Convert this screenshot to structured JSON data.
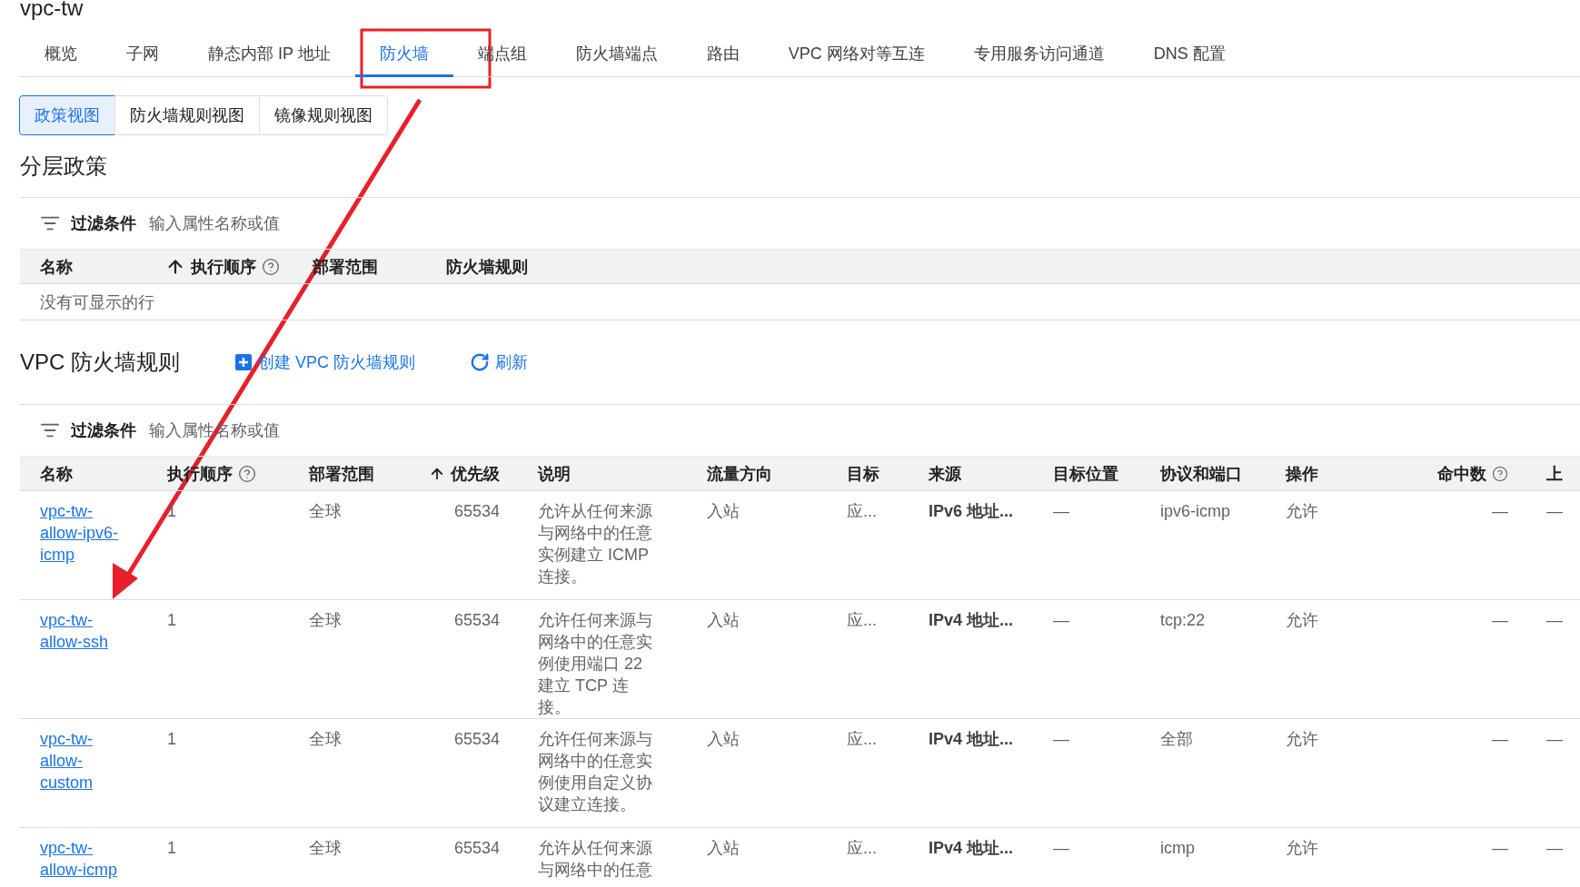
{
  "title": "vpc-tw",
  "tabs": [
    {
      "label": "概览",
      "selected": false
    },
    {
      "label": "子网",
      "selected": false
    },
    {
      "label": "静态内部 IP 地址",
      "selected": false
    },
    {
      "label": "防火墙",
      "selected": true
    },
    {
      "label": "端点组",
      "selected": false
    },
    {
      "label": "防火墙端点",
      "selected": false
    },
    {
      "label": "路由",
      "selected": false
    },
    {
      "label": "VPC 网络对等互连",
      "selected": false
    },
    {
      "label": "专用服务访问通道",
      "selected": false
    },
    {
      "label": "DNS 配置",
      "selected": false
    }
  ],
  "view_tabs": [
    {
      "label": "政策视图",
      "selected": true
    },
    {
      "label": "防火墙规则视图",
      "selected": false
    },
    {
      "label": "镜像规则视图",
      "selected": false
    }
  ],
  "hierarchical_policies": {
    "title": "分层政策",
    "filter": {
      "label": "过滤条件",
      "placeholder": "输入属性名称或值"
    },
    "columns": [
      {
        "label": "名称",
        "sorted": false,
        "help": false
      },
      {
        "label": "执行顺序",
        "sorted": true,
        "help": true
      },
      {
        "label": "部署范围",
        "sorted": false,
        "help": false
      },
      {
        "label": "防火墙规则",
        "sorted": false,
        "help": false
      }
    ],
    "empty": "没有可显示的行"
  },
  "vpc_rules": {
    "title": "VPC 防火墙规则",
    "actions": [
      {
        "label": "创建 VPC 防火墙规则",
        "kind": "create"
      },
      {
        "label": "刷新",
        "kind": "refresh"
      }
    ],
    "filter": {
      "label": "过滤条件",
      "placeholder": "输入属性名称或值"
    },
    "columns": [
      {
        "label": "名称",
        "kind": "link",
        "sorted": false,
        "help": false
      },
      {
        "label": "执行顺序",
        "kind": "text",
        "sorted": false,
        "help": true
      },
      {
        "label": "部署范围",
        "kind": "text",
        "sorted": false,
        "help": false
      },
      {
        "label": "优先级",
        "kind": "number",
        "sorted": true,
        "help": false
      },
      {
        "label": "说明",
        "kind": "text",
        "sorted": false,
        "help": false
      },
      {
        "label": "流量方向",
        "kind": "text",
        "sorted": false,
        "help": false
      },
      {
        "label": "目标",
        "kind": "text",
        "sorted": false,
        "help": false
      },
      {
        "label": "来源",
        "kind": "strong",
        "sorted": false,
        "help": false
      },
      {
        "label": "目标位置",
        "kind": "text",
        "sorted": false,
        "help": false
      },
      {
        "label": "协议和端口",
        "kind": "text",
        "sorted": false,
        "help": false
      },
      {
        "label": "操作",
        "kind": "text",
        "sorted": false,
        "help": false
      },
      {
        "label": "命中数",
        "kind": "number",
        "sorted": false,
        "help": true
      },
      {
        "label": "上",
        "kind": "text",
        "sorted": false,
        "help": false
      }
    ],
    "rows": [
      {
        "cells": [
          "vpc-tw-allow-ipv6-icmp",
          "1",
          "全球",
          "65534",
          "允许从任何来源与网络中的任意实例建立 ICMP 连接。",
          "入站",
          "应...",
          "IPv6 地址...",
          "—",
          "ipv6-icmp",
          "允许",
          "—",
          "—"
        ]
      },
      {
        "cells": [
          "vpc-tw-allow-ssh",
          "1",
          "全球",
          "65534",
          "允许任何来源与网络中的任意实例使用端口 22 建立 TCP 连接。",
          "入站",
          "应...",
          "IPv4 地址...",
          "—",
          "tcp:22",
          "允许",
          "—",
          "—"
        ]
      },
      {
        "cells": [
          "vpc-tw-allow-custom",
          "1",
          "全球",
          "65534",
          "允许任何来源与网络中的任意实例使用自定义协议建立连接。",
          "入站",
          "应...",
          "IPv4 地址...",
          "—",
          "全部",
          "允许",
          "—",
          "—"
        ]
      },
      {
        "cells": [
          "vpc-tw-allow-icmp",
          "1",
          "全球",
          "65534",
          "允许从任何来源与网络中的任意",
          "入站",
          "应...",
          "IPv4 地址...",
          "—",
          "icmp",
          "允许",
          "—",
          "—"
        ]
      }
    ]
  }
}
